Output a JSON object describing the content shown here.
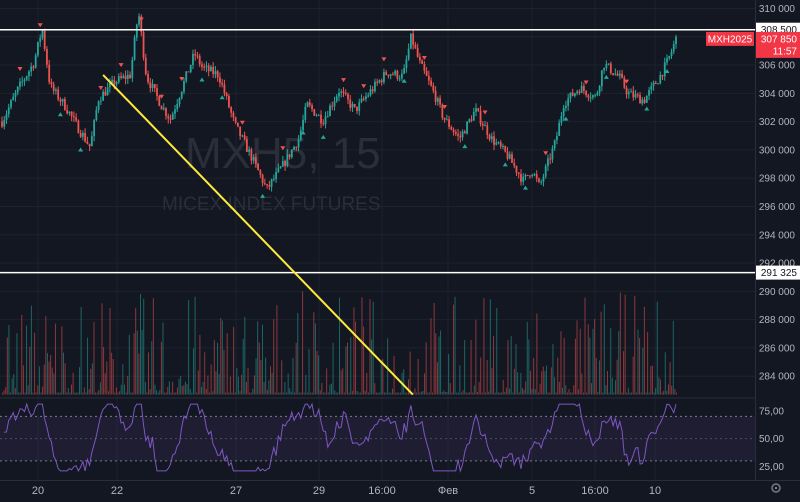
{
  "colors": {
    "background": "#131722",
    "grid": "#1e222d",
    "up": "#26a69a",
    "down": "#ef5350",
    "trendline": "#ffeb3b",
    "rsi": "#7e57c2",
    "hline": "#ffffff",
    "last_tag": "#f23645"
  },
  "watermark": {
    "symbol": "MXH5, 15",
    "name": "MICEX INDEX FUTURES"
  },
  "chart_data": {
    "type": "candlestick",
    "interval": "15",
    "symbol": "MXH2025",
    "price_axis": {
      "range": [
        282600,
        310600
      ],
      "ticks": [
        "310 000",
        "308 000",
        "306 000",
        "304 000",
        "302 000",
        "300 000",
        "298 000",
        "296 000",
        "294 000",
        "292 000",
        "290 000",
        "288 000",
        "286 000",
        "284 000"
      ],
      "tick_values": [
        310000,
        308000,
        306000,
        304000,
        302000,
        300000,
        298000,
        296000,
        294000,
        292000,
        290000,
        288000,
        286000,
        284000
      ]
    },
    "x_axis": {
      "ticks": [
        "20",
        "22",
        "27",
        "29",
        "16:00",
        "Фев",
        "5",
        "16:00",
        "10"
      ]
    },
    "price_path": [
      {
        "t": 0,
        "p": 302000
      },
      {
        "t": 2,
        "p": 304300
      },
      {
        "t": 4,
        "p": 306200
      },
      {
        "t": 5,
        "p": 308600
      },
      {
        "t": 6,
        "p": 304500
      },
      {
        "t": 8,
        "p": 303000
      },
      {
        "t": 9,
        "p": 302000
      },
      {
        "t": 11,
        "p": 300200
      },
      {
        "t": 12,
        "p": 303600
      },
      {
        "t": 14,
        "p": 304800
      },
      {
        "t": 16,
        "p": 305300
      },
      {
        "t": 17,
        "p": 309800
      },
      {
        "t": 18,
        "p": 305200
      },
      {
        "t": 20,
        "p": 303000
      },
      {
        "t": 21,
        "p": 302200
      },
      {
        "t": 24,
        "p": 306800
      },
      {
        "t": 25,
        "p": 305800
      },
      {
        "t": 27,
        "p": 305300
      },
      {
        "t": 29,
        "p": 301800
      },
      {
        "t": 31,
        "p": 299600
      },
      {
        "t": 33,
        "p": 297200
      },
      {
        "t": 35,
        "p": 298900
      },
      {
        "t": 37,
        "p": 300800
      },
      {
        "t": 38,
        "p": 303200
      },
      {
        "t": 40,
        "p": 302100
      },
      {
        "t": 42,
        "p": 304200
      },
      {
        "t": 44,
        "p": 302800
      },
      {
        "t": 46,
        "p": 304200
      },
      {
        "t": 48,
        "p": 305500
      },
      {
        "t": 50,
        "p": 305200
      },
      {
        "t": 51,
        "p": 308000
      },
      {
        "t": 52,
        "p": 306200
      },
      {
        "t": 54,
        "p": 303800
      },
      {
        "t": 55,
        "p": 302300
      },
      {
        "t": 57,
        "p": 300800
      },
      {
        "t": 59,
        "p": 302800
      },
      {
        "t": 61,
        "p": 300800
      },
      {
        "t": 63,
        "p": 299600
      },
      {
        "t": 65,
        "p": 297800
      },
      {
        "t": 66,
        "p": 298600
      },
      {
        "t": 67,
        "p": 297400
      },
      {
        "t": 69,
        "p": 300600
      },
      {
        "t": 70,
        "p": 303300
      },
      {
        "t": 72,
        "p": 304400
      },
      {
        "t": 74,
        "p": 303700
      },
      {
        "t": 75,
        "p": 306100
      },
      {
        "t": 77,
        "p": 305100
      },
      {
        "t": 78,
        "p": 304000
      },
      {
        "t": 80,
        "p": 303500
      },
      {
        "t": 82,
        "p": 305200
      },
      {
        "t": 83,
        "p": 306300
      },
      {
        "t": 84,
        "p": 307850
      }
    ],
    "last_price": {
      "label": "MXH2025",
      "value": "307 850",
      "countdown": "11:57"
    },
    "horizontal_lines": [
      {
        "value": 308500,
        "label": "308 500"
      },
      {
        "value": 291325,
        "label": "291 325"
      }
    ],
    "trendline": {
      "from": {
        "t": 12.6,
        "p": 305300
      },
      "to": {
        "t": 51.2,
        "p": 282700
      }
    },
    "volume": {
      "baseline_price": 282700,
      "max_price": 290000
    },
    "rsi": {
      "ticks": [
        "75,00",
        "50,00",
        "25,00"
      ],
      "tick_values": [
        75,
        50,
        25
      ],
      "band": [
        30,
        70
      ],
      "range": [
        20,
        82
      ]
    },
    "grid": true
  }
}
